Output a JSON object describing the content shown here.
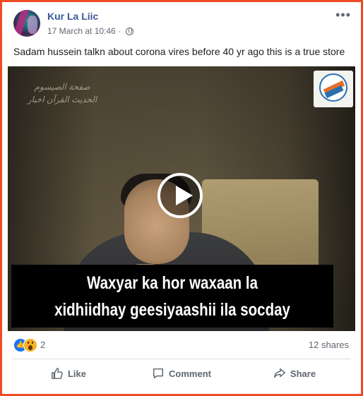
{
  "post": {
    "author": "Kur La Liic",
    "timestamp": "17 March at 10:46",
    "separator": "·",
    "text": "Sadam hussein talkn about corona vires before 40 yr ago this is a true store",
    "more_menu": "•••"
  },
  "video": {
    "watermark_lines": [
      "صفحة الصيسوم",
      "الحديث القرآن اخبار"
    ],
    "caption_line1": "Waxyar ka hor waxaan la",
    "caption_line2": "xidhiidhay geesiyaashii ila socday"
  },
  "engagement": {
    "reaction_count": "2",
    "shares": "12 shares"
  },
  "actions": {
    "like": "Like",
    "comment": "Comment",
    "share": "Share"
  },
  "colors": {
    "border_highlight": "#f04a24",
    "author_link": "#385898",
    "like_blue": "#1877f2",
    "wow_yellow": "#f7b125"
  },
  "icons": [
    "globe-icon",
    "more-options-icon",
    "play-icon",
    "like-reaction-icon",
    "wow-reaction-icon",
    "thumbs-up-icon",
    "comment-icon",
    "share-arrow-icon"
  ]
}
